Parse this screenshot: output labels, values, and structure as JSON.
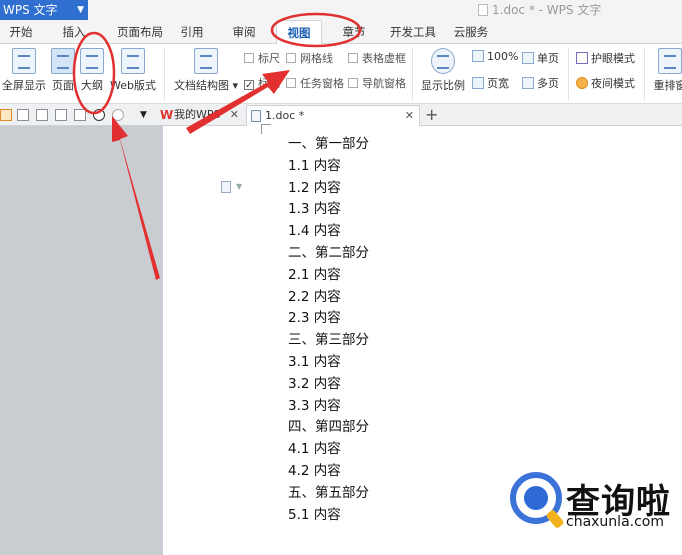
{
  "app": {
    "menu_label": "WPS 文字",
    "window_title": "1.doc * - WPS 文字"
  },
  "ribbon_tabs": [
    {
      "label": "开始",
      "active": false
    },
    {
      "label": "插入",
      "active": false
    },
    {
      "label": "页面布局",
      "active": false
    },
    {
      "label": "引用",
      "active": false
    },
    {
      "label": "审阅",
      "active": false
    },
    {
      "label": "视图",
      "active": true
    },
    {
      "label": "章节",
      "active": false
    },
    {
      "label": "开发工具",
      "active": false
    },
    {
      "label": "云服务",
      "active": false
    }
  ],
  "view_ribbon": {
    "fullscreen": "全屏显示",
    "page": "页面",
    "outline": "大纲",
    "web_layout": "Web版式",
    "doc_map": "文档结构图",
    "ruler": "标尺",
    "gridlines": "网格线",
    "table_border": "表格虚框",
    "markup": "标记",
    "task_pane": "任务窗格",
    "nav_pane": "导航窗格",
    "zoom": "显示比例",
    "zoom_percent": "100%",
    "page_width": "页宽",
    "single_page": "单页",
    "multi_page": "多页",
    "eye_protect": "护眼模式",
    "night_mode": "夜间模式",
    "rearrange": "重排窗"
  },
  "doc_tabs": [
    {
      "label": "我的WPS",
      "active": false
    },
    {
      "label": "1.doc *",
      "active": true
    }
  ],
  "document": {
    "lines": [
      "一、第一部分",
      "1.1 内容",
      "1.2 内容",
      "1.3 内容",
      "1.4 内容",
      "二、第二部分",
      "2.1 内容",
      "2.2 内容",
      "2.3 内容",
      "三、第三部分",
      "3.1 内容",
      "3.2 内容",
      "3.3 内容",
      "四、第四部分",
      "4.1 内容",
      "4.2 内容",
      "五、第五部分",
      "5.1 内容"
    ]
  },
  "watermark": {
    "brand": "查询啦",
    "url": "chaxunla.com"
  },
  "annotation_color": "#e23030"
}
